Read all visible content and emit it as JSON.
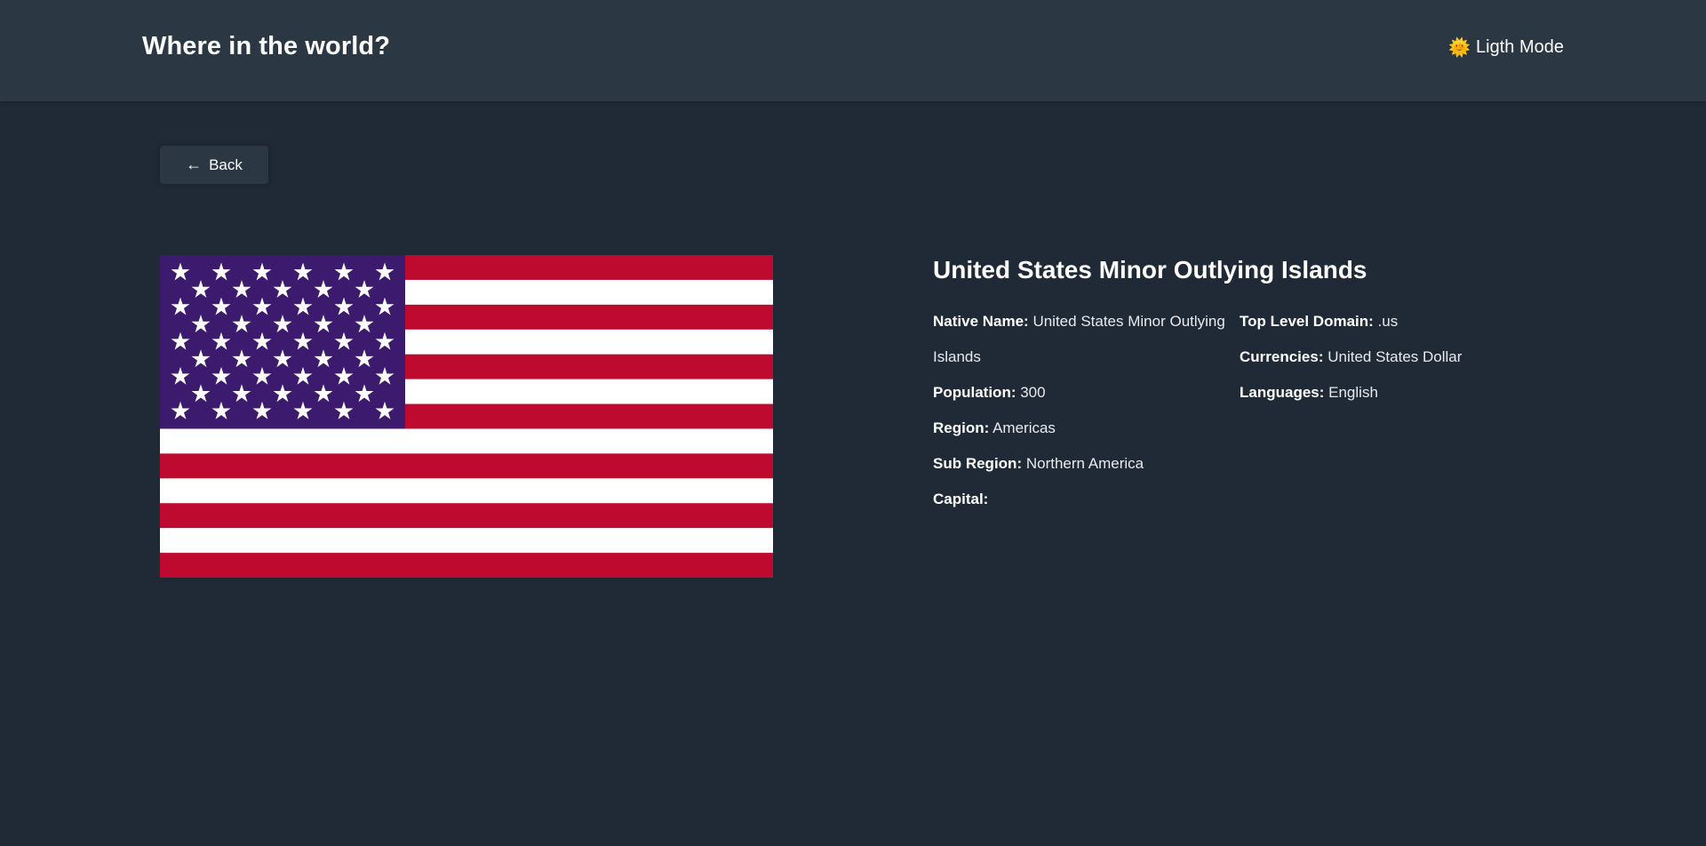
{
  "header": {
    "title": "Where in the world?",
    "mode_icon": "🌞",
    "mode_label": "Ligth Mode"
  },
  "back_button": {
    "arrow": "←",
    "label": "Back"
  },
  "country": {
    "name": "United States Minor Outlying Islands",
    "flag_icon": "us-flag",
    "col1": [
      {
        "label": "Native Name:",
        "value": "United States Minor Outlying Islands"
      },
      {
        "label": "Population:",
        "value": "300"
      },
      {
        "label": "Region:",
        "value": "Americas"
      },
      {
        "label": "Sub Region:",
        "value": "Northern America"
      },
      {
        "label": "Capital:",
        "value": ""
      }
    ],
    "col2": [
      {
        "label": "Top Level Domain:",
        "value": ".us"
      },
      {
        "label": "Currencies:",
        "value": "United States Dollar"
      },
      {
        "label": "Languages:",
        "value": "English"
      }
    ]
  },
  "colors": {
    "background": "#202936",
    "header": "#2b3743",
    "flag_red": "#bf0a30",
    "flag_blue": "#3c1a6e",
    "flag_white": "#ffffff"
  }
}
